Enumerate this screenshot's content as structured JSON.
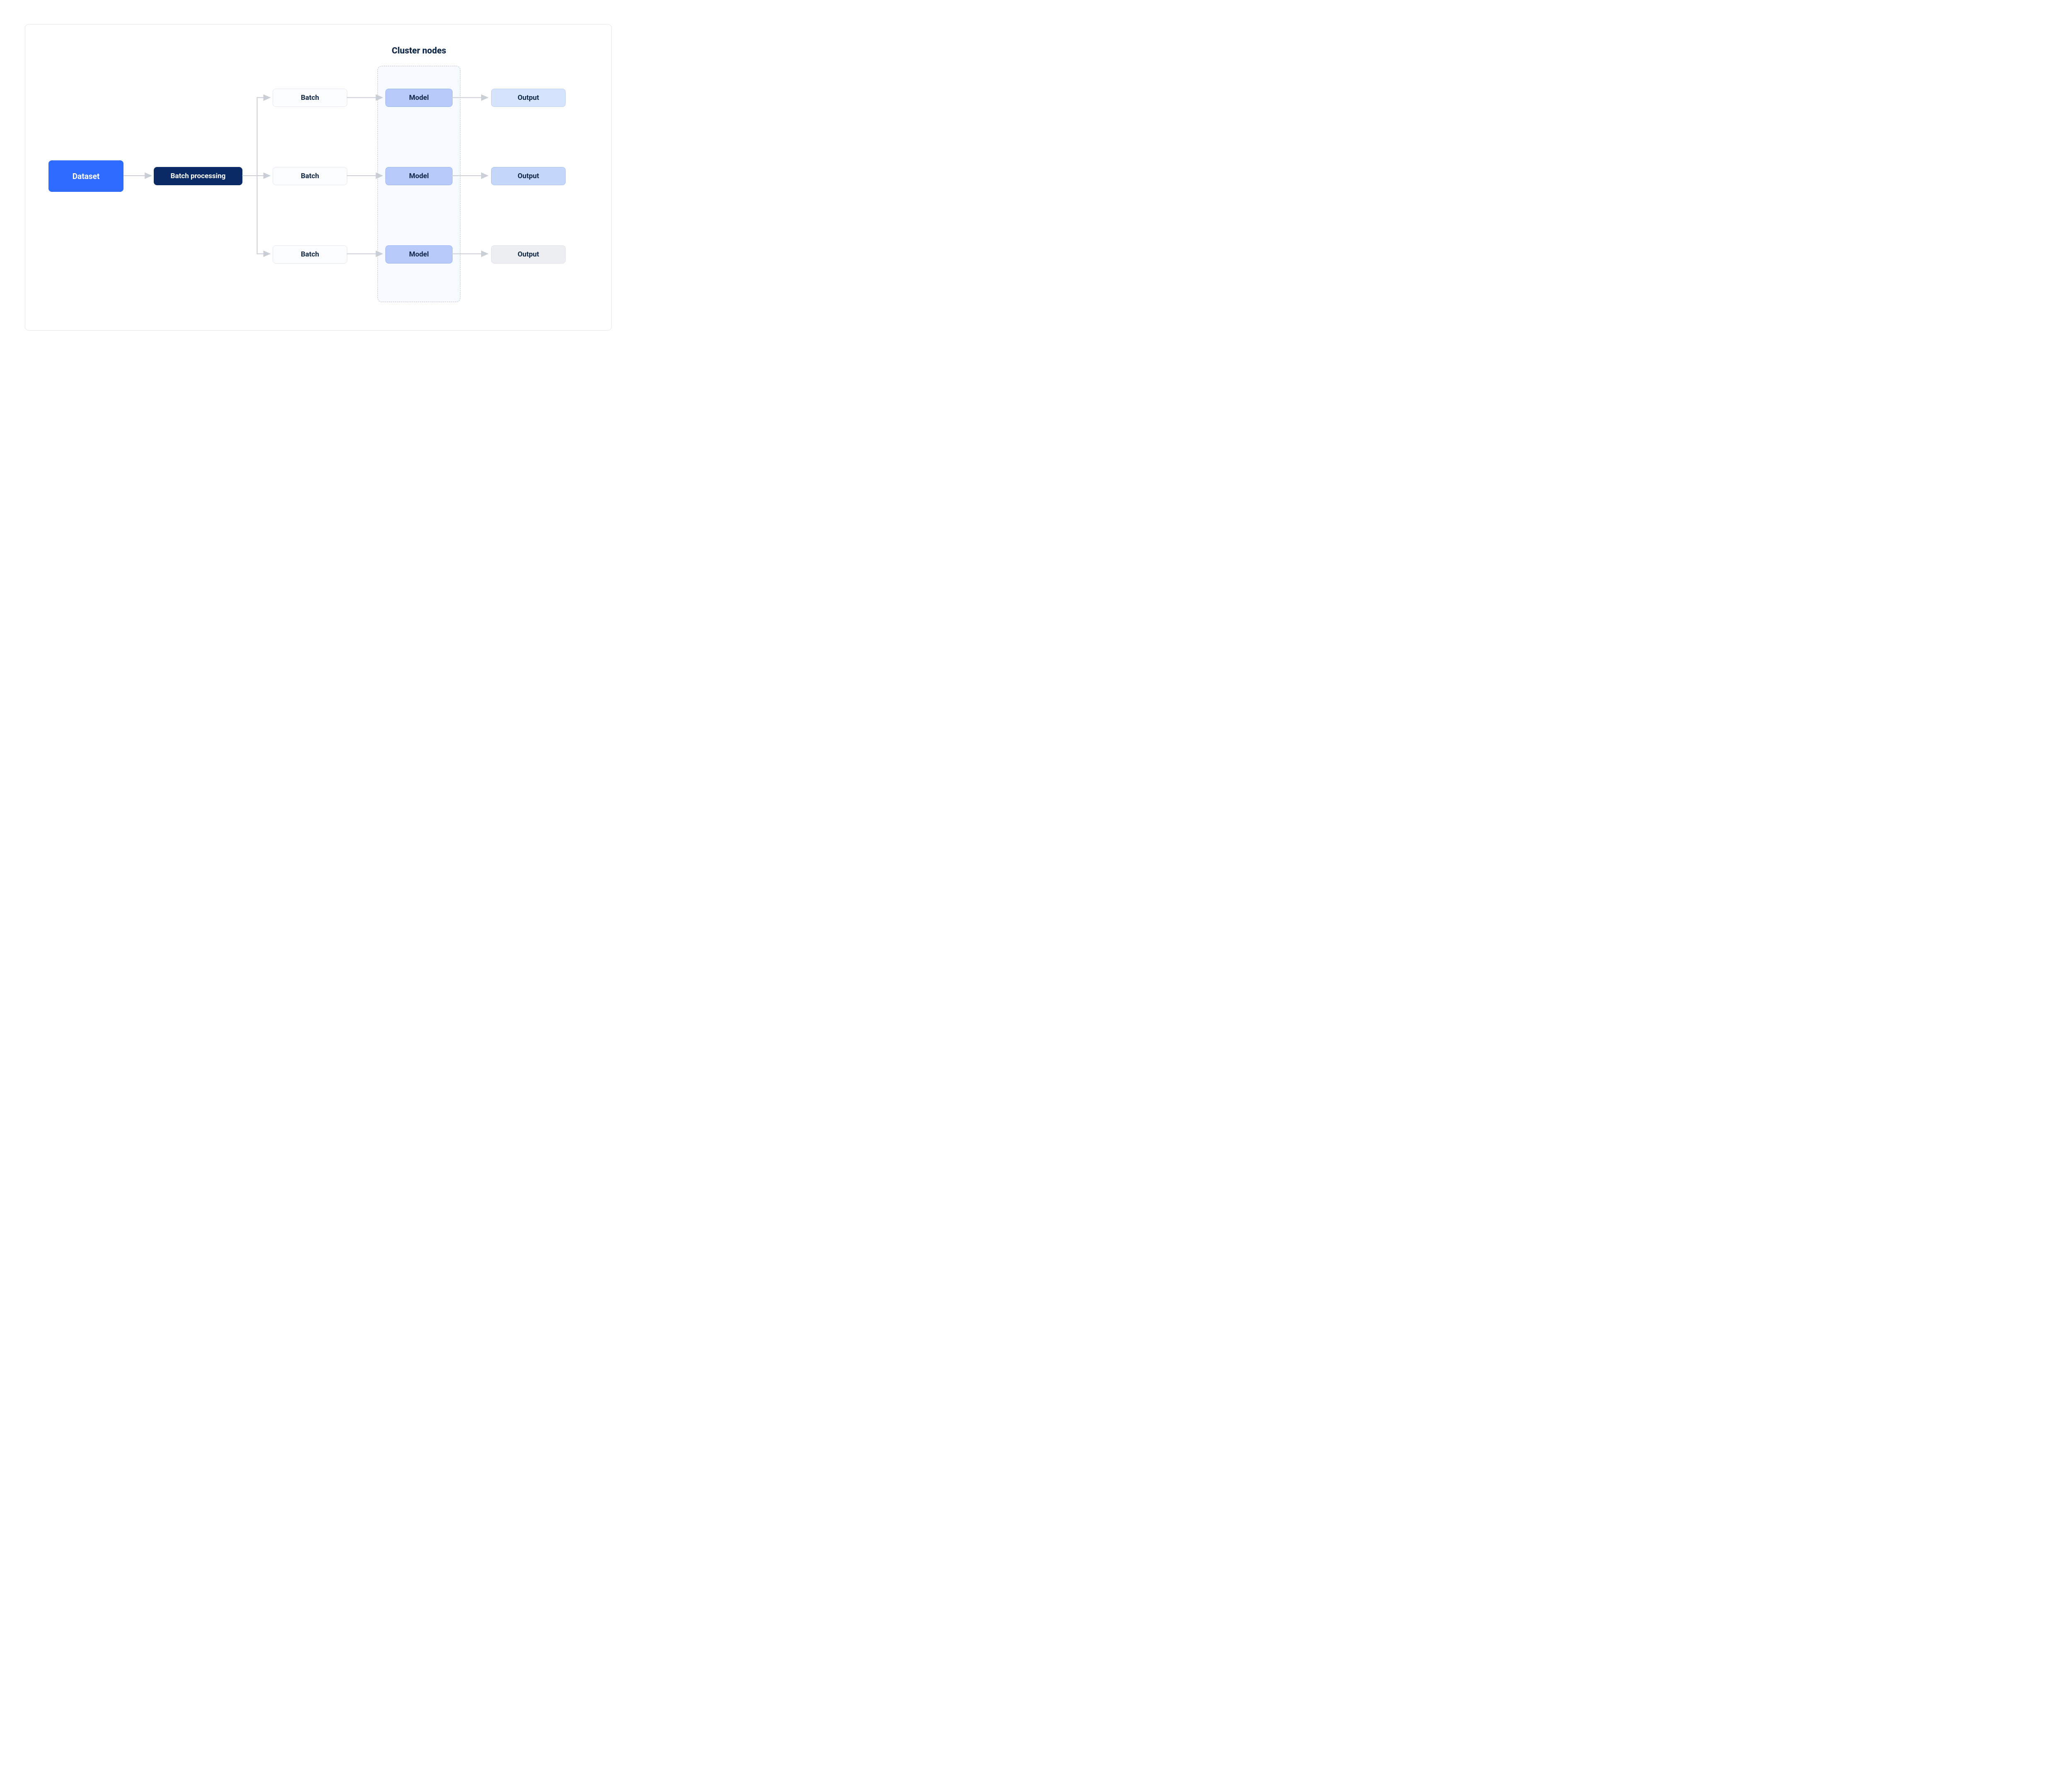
{
  "nodes": {
    "dataset": "Dataset",
    "batch_processing": "Batch processing",
    "batch": [
      "Batch",
      "Batch",
      "Batch"
    ],
    "model": [
      "Model",
      "Model",
      "Model"
    ],
    "output": [
      "Output",
      "Output",
      "Output"
    ]
  },
  "cluster_title": "Cluster nodes",
  "colors": {
    "dataset_bg": "#2f6bff",
    "batchproc_bg": "#0a2a66",
    "batch_bg": "#fcfdfe",
    "model_bg": "#b7caf9",
    "output_light_bg": "#d6e3fc",
    "output_mid_bg": "#c4d7fb",
    "output_gray_bg": "#edeef1",
    "text_dark": "#0f2747",
    "arrow": "#c9ced7",
    "cluster_border": "#b9bfc9",
    "cluster_bg": "#f7faff"
  }
}
